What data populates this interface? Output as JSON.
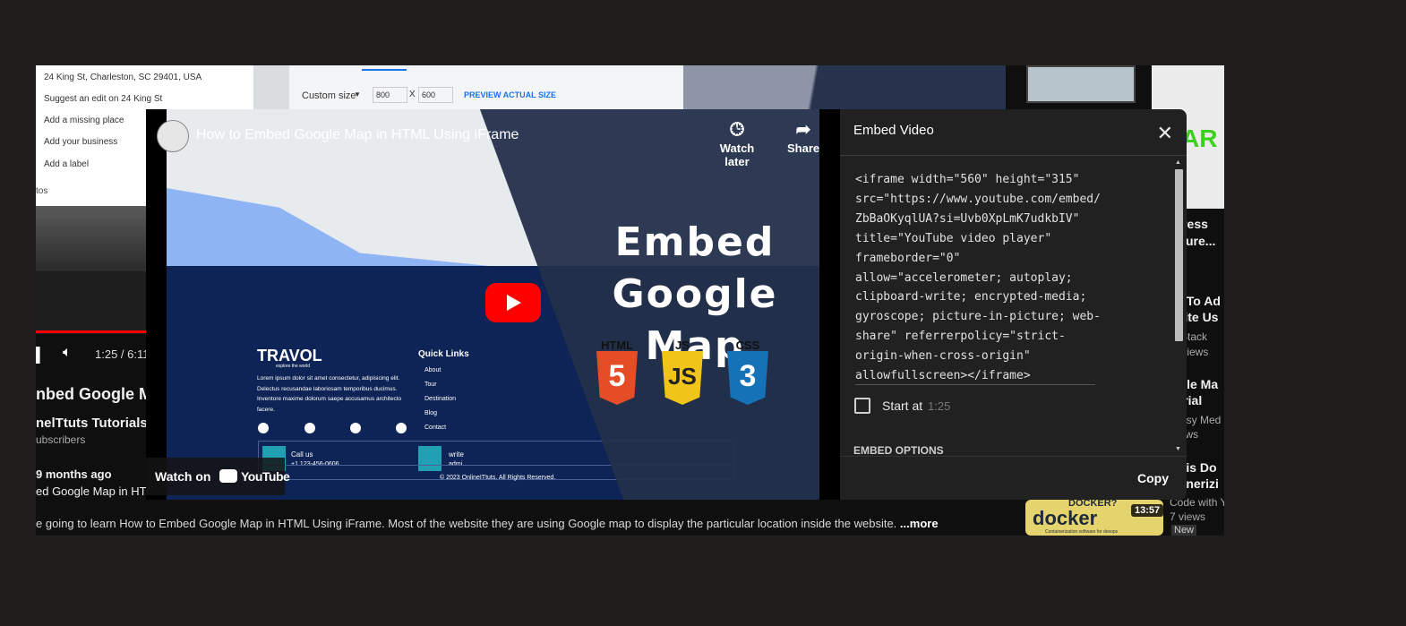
{
  "background": {
    "map_menu": [
      "24 King St, Charleston, SC 29401, USA",
      "Suggest an edit on 24 King St",
      "Add a missing place",
      "Add your business",
      "Add a label"
    ],
    "photos_label": "tos",
    "custom_size": {
      "label": "Custom size",
      "width": "800",
      "x": "X",
      "height": "600",
      "preview": "PREVIEW ACTUAL SIZE"
    },
    "time": "1:25 / 6:11",
    "video_title": "nbed Google M",
    "channel": "nelTtuts Tutorials",
    "subscribers": "ubscribers",
    "ago": "9 months ago",
    "video_title2": "ed Google Map in HT",
    "description": "e going to learn How to Embed Google Map in HTML Using iFrame. Most of the website they are using Google map to display the particular location inside the website.",
    "more": "...more",
    "right_col": {
      "item1": [
        "ogress",
        "g pure..."
      ],
      "item2": [
        "w To Ad",
        "bsite Us",
        "atStack",
        "K views"
      ],
      "item3": [
        "ogle Ma",
        "torial",
        "versy Med",
        "views"
      ],
      "item4": [
        "at is Do",
        "tainerizi"
      ],
      "docker": "docker",
      "docker_q": "DOCKER?",
      "docker_sub": "Containerization software for devops",
      "duration": "13:57",
      "channel4": "Code with Yo",
      "views4": "7 views",
      "new": "New",
      "green_text": "AR"
    }
  },
  "player": {
    "title": "How to Embed Google Map in HTML Using iFrame",
    "watch_later": "Watch later",
    "share": "Share",
    "thumbnail_title": [
      "Embed",
      "Google Map"
    ],
    "watch_on": "Watch on",
    "youtube": "YouTube",
    "badges": [
      "HTML",
      "JS",
      "CSS"
    ],
    "badge_glyphs": [
      "5",
      "JS",
      "3"
    ],
    "site": {
      "call": "Call us",
      "phone": "+1 123-456-0606",
      "write": "write",
      "admin": "admi",
      "logo": "TRAVOL",
      "logo_sub": "explore the world",
      "lorem": "Lorem ipsum dolor sit amet consectetur, adipisicing elit. Delectus recusandae laboriosam temporibus ducimus. Inventore maxime dolorum saepe accusamus architecto facere.",
      "quick_links": "Quick Links",
      "links": [
        "About",
        "Tour",
        "Destination",
        "Blog",
        "Contact"
      ],
      "copyright": "© 2023 OnlineITtuts. All Rights Reserved."
    }
  },
  "embed_panel": {
    "title": "Embed Video",
    "code": "<iframe width=\"560\" height=\"315\"\nsrc=\"https://www.youtube.com/embed/\nZbBaOKyqlUA?si=Uvb0XpLmK7udkbIV\"\ntitle=\"YouTube video player\"\nframeborder=\"0\"\nallow=\"accelerometer; autoplay;\nclipboard-write; encrypted-media;\ngyroscope; picture-in-picture; web-\nshare\" referrerpolicy=\"strict-\norigin-when-cross-origin\"\nallowfullscreen></iframe>",
    "start_at": "Start at",
    "start_time": "1:25",
    "embed_options": "EMBED OPTIONS",
    "copy": "Copy"
  },
  "colors": {
    "panel": "#212121",
    "yt_red": "#ff0000",
    "html5": "#e44d26",
    "js": "#f0c419",
    "css3": "#1572b6"
  }
}
